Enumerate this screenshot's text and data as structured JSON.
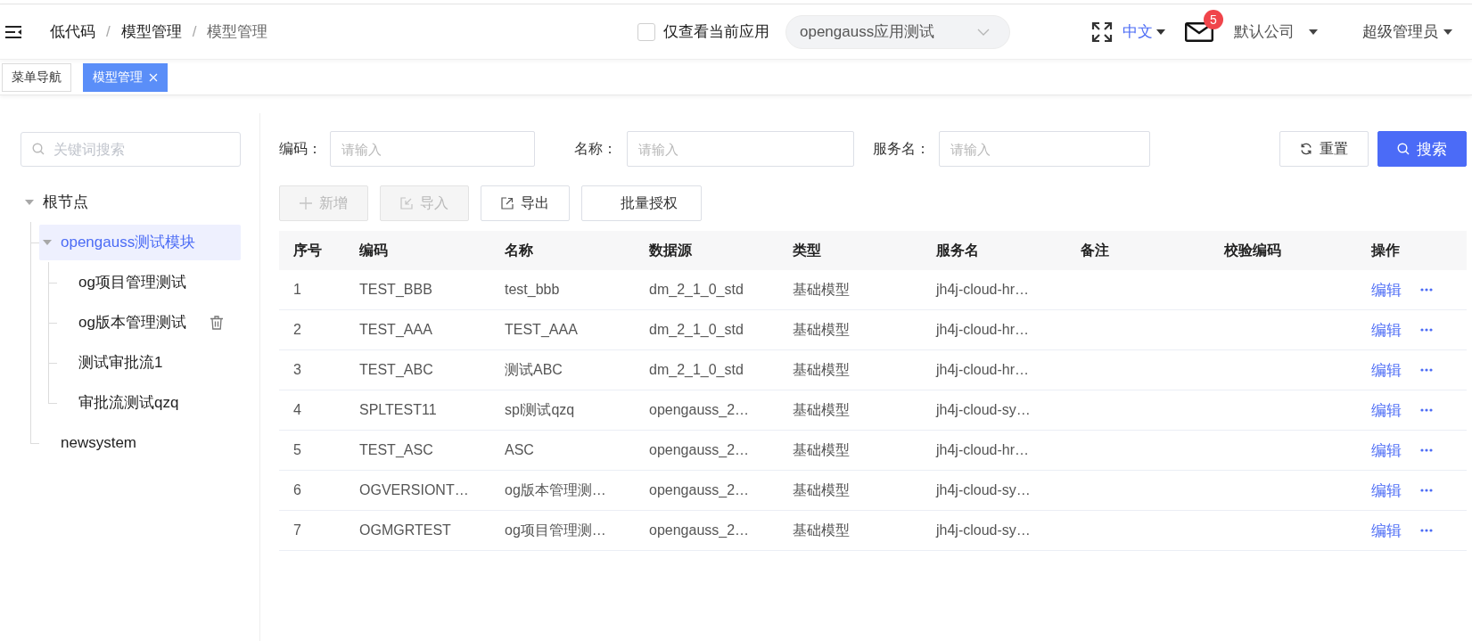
{
  "header": {
    "breadcrumb": [
      {
        "kind": "link",
        "text": "低代码"
      },
      {
        "kind": "separator",
        "text": "/"
      },
      {
        "kind": "link",
        "text": "模型管理"
      },
      {
        "kind": "separator",
        "text": "/"
      },
      {
        "kind": "current",
        "text": "模型管理"
      }
    ],
    "app_filter": {
      "label": "仅查看当前应用",
      "checked": false
    },
    "app_select": {
      "value": "opengauss应用测试"
    },
    "language": "中文",
    "mail_badge": "5",
    "company": "默认公司",
    "user": "超级管理员"
  },
  "tabs": [
    {
      "label": "菜单导航",
      "selected": false,
      "closable": false
    },
    {
      "label": "模型管理",
      "selected": true,
      "closable": true
    }
  ],
  "tree": {
    "search": {
      "placeholder": "关键词搜索"
    },
    "nodes": [
      {
        "label": "根节点",
        "expanded": true,
        "selected": false,
        "hovered": false,
        "children": [
          {
            "label": "opengauss测试模块",
            "expanded": true,
            "selected": true,
            "hovered": false,
            "children": [
              {
                "label": "og项目管理测试",
                "selected": false,
                "hovered": false
              },
              {
                "label": "og版本管理测试",
                "selected": false,
                "hovered": true
              },
              {
                "label": "测试审批流1",
                "selected": false,
                "hovered": false
              },
              {
                "label": "审批流测试qzq",
                "selected": false,
                "hovered": false
              }
            ]
          },
          {
            "label": "newsystem",
            "selected": false,
            "hovered": false
          }
        ]
      }
    ]
  },
  "filters": [
    {
      "label": "编码：",
      "placeholder": "请输入"
    },
    {
      "label": "名称：",
      "placeholder": "请输入"
    },
    {
      "label": "服务名：",
      "placeholder": "请输入"
    }
  ],
  "filter_buttons": [
    {
      "kind": "reset",
      "label": "重置"
    },
    {
      "kind": "search",
      "label": "搜索"
    }
  ],
  "actions": [
    {
      "kind": "add",
      "label": "新增",
      "disabled": true
    },
    {
      "kind": "import",
      "label": "导入",
      "disabled": true
    },
    {
      "kind": "export",
      "label": "导出",
      "disabled": false
    },
    {
      "kind": "authorize",
      "label": "批量授权",
      "disabled": false
    }
  ],
  "table": {
    "columns": [
      "序号",
      "编码",
      "名称",
      "数据源",
      "类型",
      "服务名",
      "备注",
      "校验编码",
      "操作"
    ],
    "rows": [
      {
        "index": "1",
        "code": "TEST_BBB",
        "name": "test_bbb",
        "datasource": "dm_2_1_0_std",
        "type": "基础模型",
        "service": "jh4j-cloud-hr…",
        "action": "编辑"
      },
      {
        "index": "2",
        "code": "TEST_AAA",
        "name": "TEST_AAA",
        "datasource": "dm_2_1_0_std",
        "type": "基础模型",
        "service": "jh4j-cloud-hr…",
        "action": "编辑"
      },
      {
        "index": "3",
        "code": "TEST_ABC",
        "name": "测试ABC",
        "datasource": "dm_2_1_0_std",
        "type": "基础模型",
        "service": "jh4j-cloud-hr…",
        "action": "编辑"
      },
      {
        "index": "4",
        "code": "SPLTEST11",
        "name": "spl测试qzq",
        "datasource": "opengauss_2…",
        "type": "基础模型",
        "service": "jh4j-cloud-sy…",
        "action": "编辑"
      },
      {
        "index": "5",
        "code": "TEST_ASC",
        "name": "ASC",
        "datasource": "opengauss_2…",
        "type": "基础模型",
        "service": "jh4j-cloud-hr…",
        "action": "编辑"
      },
      {
        "index": "6",
        "code": "OGVERSIONT…",
        "name": "og版本管理测…",
        "datasource": "opengauss_2…",
        "type": "基础模型",
        "service": "jh4j-cloud-sy…",
        "action": "编辑"
      },
      {
        "index": "7",
        "code": "OGMGRTEST",
        "name": "og项目管理测…",
        "datasource": "opengauss_2…",
        "type": "基础模型",
        "service": "jh4j-cloud-sy…",
        "action": "编辑"
      }
    ]
  }
}
